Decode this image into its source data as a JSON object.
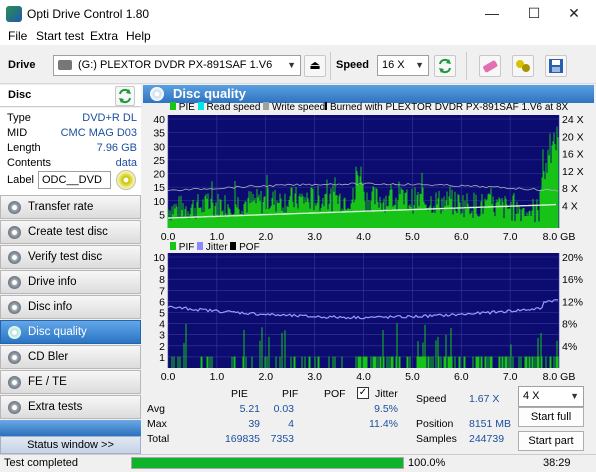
{
  "window": {
    "title": "Opti Drive Control 1.80"
  },
  "menu": [
    "File",
    "Start test",
    "Extra",
    "Help"
  ],
  "toolbar": {
    "drive_label": "Drive",
    "drive_value": "(G:)  PLEXTOR DVDR   PX-891SAF 1.V6",
    "speed_label": "Speed",
    "speed_value": "16 X"
  },
  "disc": {
    "header": "Disc",
    "rows": [
      {
        "key": "Type",
        "value": "DVD+R DL"
      },
      {
        "key": "MID",
        "value": "CMC MAG D03"
      },
      {
        "key": "Length",
        "value": "7.96 GB"
      },
      {
        "key": "Contents",
        "value": "data"
      }
    ],
    "label_key": "Label",
    "label_value": "ODC__DVD"
  },
  "nav": [
    "Transfer rate",
    "Create test disc",
    "Verify test disc",
    "Drive info",
    "Disc info",
    "Disc quality",
    "CD Bler",
    "FE / TE",
    "Extra tests"
  ],
  "nav_active": "Disc quality",
  "status_window": "Status window >>",
  "panel_title": "Disc quality",
  "chart_top": {
    "legend": [
      "PIE",
      "Read speed",
      "Write speed",
      "Burned with PLEXTOR DVDR   PX-891SAF 1.V6 at 8X"
    ],
    "legend_colors": [
      "#19c519",
      "#00e5e5",
      "#a0a0a0",
      ""
    ],
    "y_left_ticks": [
      "40",
      "35",
      "30",
      "25",
      "20",
      "15",
      "10",
      "5"
    ],
    "y_right_ticks": [
      "24 X",
      "20 X",
      "16 X",
      "12 X",
      "8 X",
      "4 X"
    ],
    "x_ticks": [
      "0.0",
      "1.0",
      "2.0",
      "3.0",
      "4.0",
      "5.0",
      "6.0",
      "7.0",
      "8.0 GB"
    ]
  },
  "chart_bottom": {
    "legend": [
      "PIF",
      "Jitter",
      "POF"
    ],
    "legend_colors": [
      "#19c519",
      "#8a8aff",
      "#000000"
    ],
    "y_left_ticks": [
      "10",
      "9",
      "8",
      "7",
      "6",
      "5",
      "4",
      "3",
      "2",
      "1"
    ],
    "y_right_ticks": [
      "20%",
      "16%",
      "12%",
      "8%",
      "4%"
    ],
    "x_ticks": [
      "0.0",
      "1.0",
      "2.0",
      "3.0",
      "4.0",
      "5.0",
      "6.0",
      "7.0",
      "8.0 GB"
    ]
  },
  "stats": {
    "cols": [
      "PIE",
      "PIF",
      "POF",
      "Jitter"
    ],
    "rows": [
      {
        "label": "Avg",
        "pie": "5.21",
        "pif": "0.03",
        "pof": "",
        "jitter": "9.5%"
      },
      {
        "label": "Max",
        "pie": "39",
        "pif": "4",
        "pof": "",
        "jitter": "11.4%"
      },
      {
        "label": "Total",
        "pie": "169835",
        "pif": "7353",
        "pof": "",
        "jitter": ""
      }
    ],
    "speed_label": "Speed",
    "speed_value": "1.67 X",
    "position_label": "Position",
    "position_value": "8151 MB",
    "samples_label": "Samples",
    "samples_value": "244739",
    "speed_select": "4 X",
    "start_full": "Start full",
    "start_part": "Start part"
  },
  "status": {
    "text": "Test completed",
    "progress_text": "100.0%",
    "progress": 1.0,
    "time": "38:29"
  }
}
